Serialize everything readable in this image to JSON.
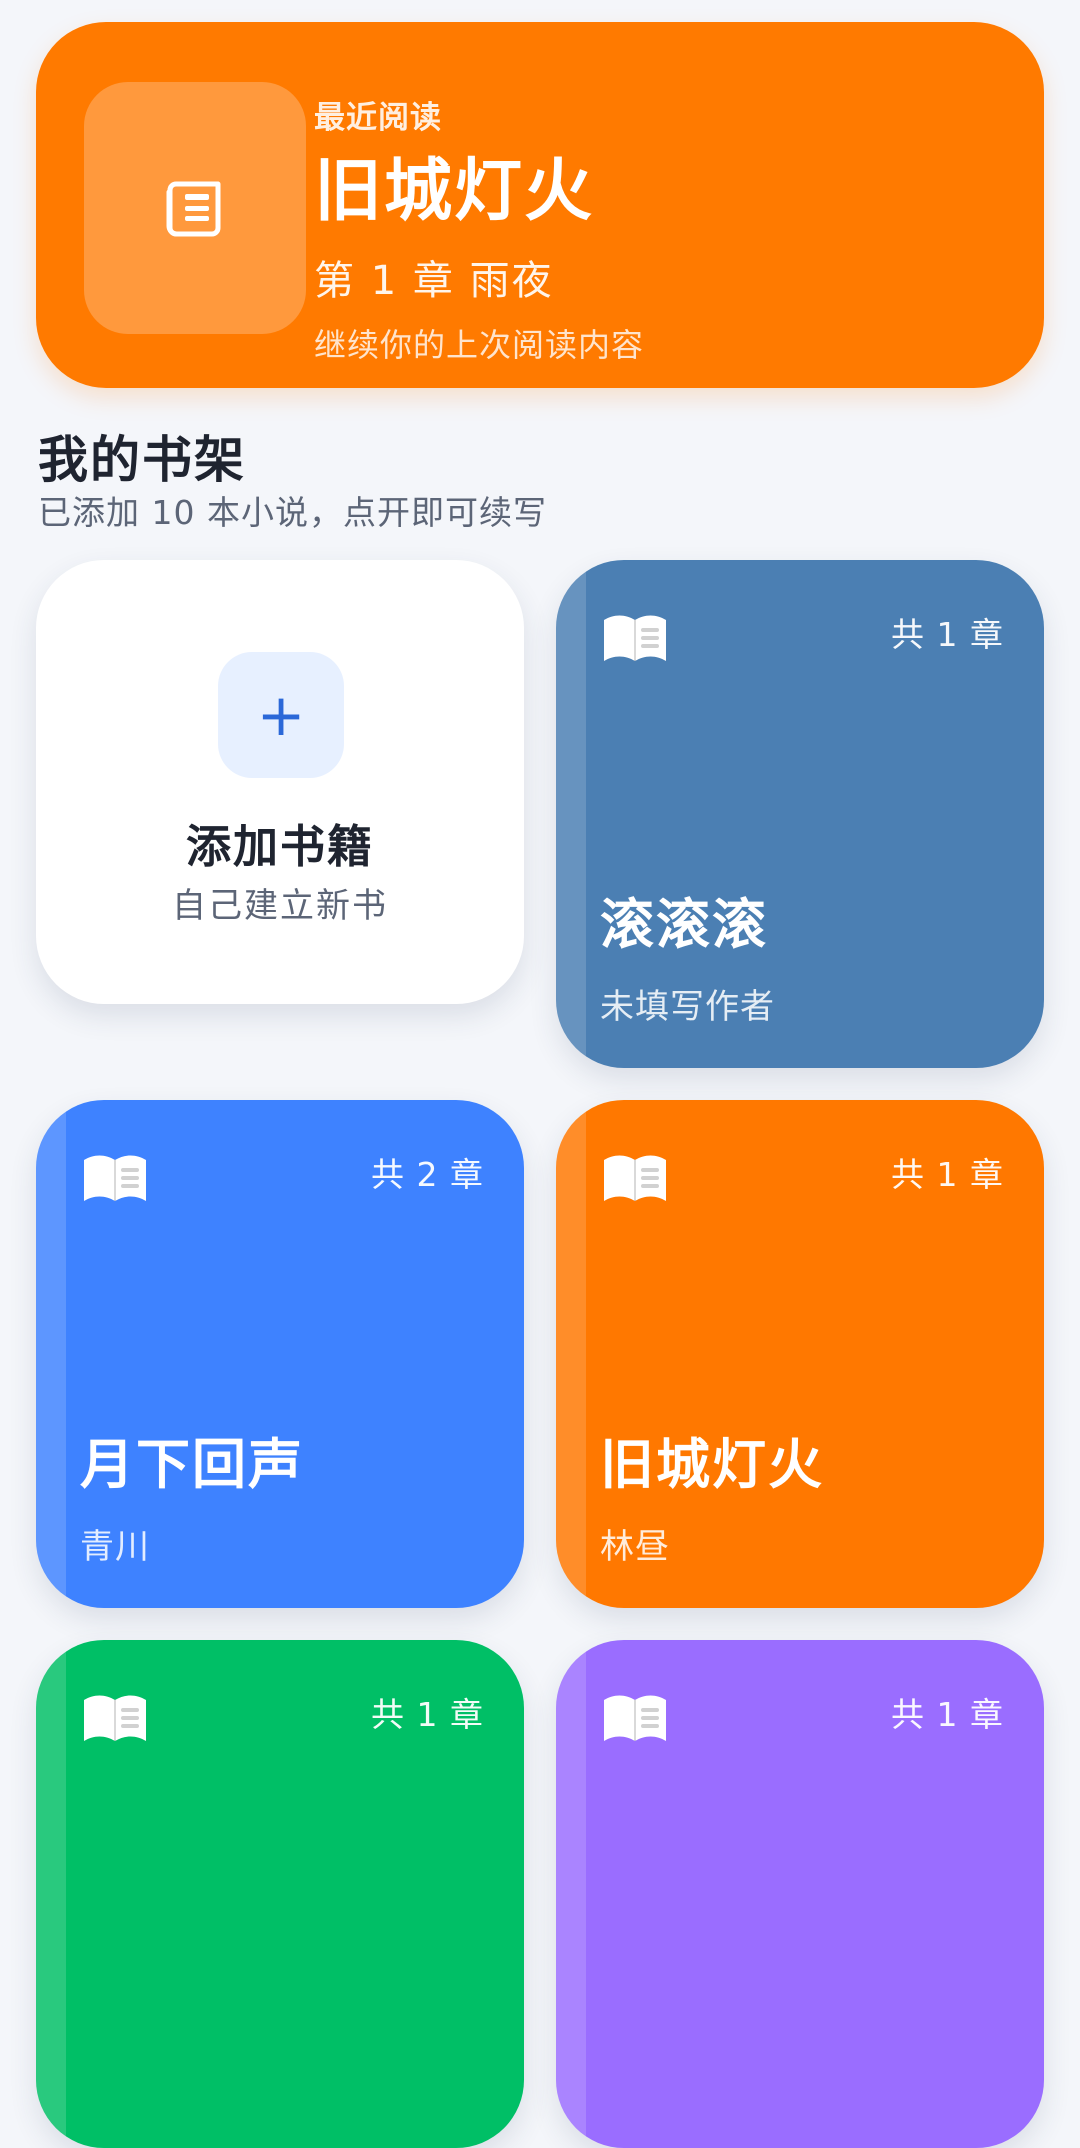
{
  "recent": {
    "eyebrow": "最近阅读",
    "title": "旧城灯火",
    "chapter": "第 1 章 雨夜",
    "description": "继续你的上次阅读内容",
    "color": "#ff7a00"
  },
  "bookshelf": {
    "title": "我的书架",
    "subtitle": "已添加 10 本小说，点开即可续写",
    "add": {
      "title": "添加书籍",
      "subtitle": "自己建立新书",
      "icon": "plus-icon"
    },
    "books": [
      {
        "title": "滚滚滚",
        "author": "未填写作者",
        "count": "共 1 章",
        "color": "#4b7fb3"
      },
      {
        "title": "月下回声",
        "author": "青川",
        "count": "共 2 章",
        "color": "#3e82ff"
      },
      {
        "title": "旧城灯火",
        "author": "林昼",
        "count": "共 1 章",
        "color": "#ff7800"
      },
      {
        "title": "",
        "author": "",
        "count": "共 1 章",
        "color": "#00bf66"
      },
      {
        "title": "",
        "author": "",
        "count": "共 1 章",
        "color": "#9a6dff"
      }
    ]
  },
  "icons": {
    "recent_cover": "newspaper-icon",
    "book": "book-icon"
  }
}
